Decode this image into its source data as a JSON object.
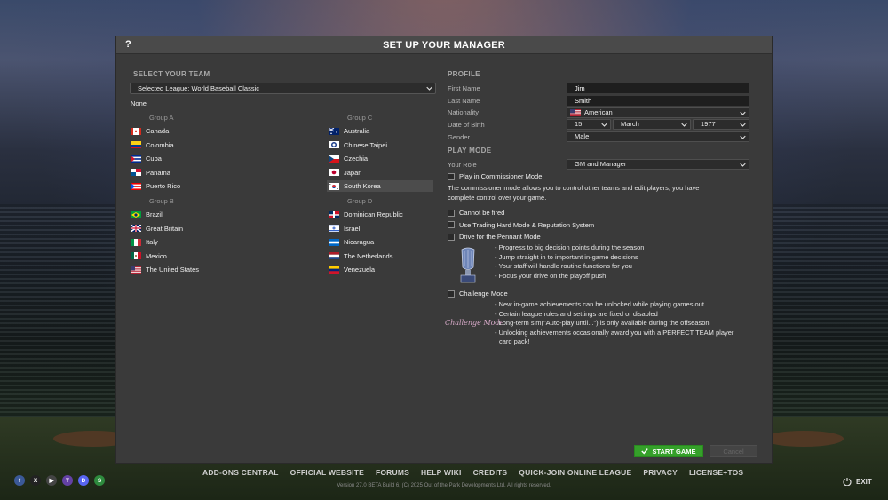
{
  "dialog": {
    "title": "SET UP YOUR MANAGER",
    "help_label": "?"
  },
  "team_section": {
    "header": "SELECT YOUR TEAM",
    "league_select": "Selected League: World Baseball Classic",
    "none_label": "None",
    "groups": [
      {
        "name": "Group A",
        "teams": [
          {
            "name": "Canada",
            "flag": "canada-flag-icon"
          },
          {
            "name": "Colombia",
            "flag": "colombia-flag-icon"
          },
          {
            "name": "Cuba",
            "flag": "cuba-flag-icon"
          },
          {
            "name": "Panama",
            "flag": "panama-flag-icon"
          },
          {
            "name": "Puerto Rico",
            "flag": "puerto-rico-flag-icon"
          }
        ]
      },
      {
        "name": "Group B",
        "teams": [
          {
            "name": "Brazil",
            "flag": "brazil-flag-icon"
          },
          {
            "name": "Great Britain",
            "flag": "great-britain-flag-icon"
          },
          {
            "name": "Italy",
            "flag": "italy-flag-icon"
          },
          {
            "name": "Mexico",
            "flag": "mexico-flag-icon"
          },
          {
            "name": "The United States",
            "flag": "usa-flag-icon"
          }
        ]
      },
      {
        "name": "Group C",
        "teams": [
          {
            "name": "Australia",
            "flag": "australia-flag-icon"
          },
          {
            "name": "Chinese Taipei",
            "flag": "chinese-taipei-flag-icon"
          },
          {
            "name": "Czechia",
            "flag": "czechia-flag-icon"
          },
          {
            "name": "Japan",
            "flag": "japan-flag-icon"
          },
          {
            "name": "South Korea",
            "flag": "south-korea-flag-icon",
            "selected": true
          }
        ]
      },
      {
        "name": "Group D",
        "teams": [
          {
            "name": "Dominican Republic",
            "flag": "dominican-republic-flag-icon"
          },
          {
            "name": "Israel",
            "flag": "israel-flag-icon"
          },
          {
            "name": "Nicaragua",
            "flag": "nicaragua-flag-icon"
          },
          {
            "name": "The Netherlands",
            "flag": "netherlands-flag-icon"
          },
          {
            "name": "Venezuela",
            "flag": "venezuela-flag-icon"
          }
        ]
      }
    ]
  },
  "profile": {
    "header": "PROFILE",
    "first_name_label": "First Name",
    "first_name_value": "Jim",
    "last_name_label": "Last Name",
    "last_name_value": "Smith",
    "nationality_label": "Nationality",
    "nationality_value": "American",
    "dob_label": "Date of Birth",
    "dob_day": "15",
    "dob_month": "March",
    "dob_year": "1977",
    "gender_label": "Gender",
    "gender_value": "Male"
  },
  "play_mode": {
    "header": "PLAY MODE",
    "role_label": "Your Role",
    "role_value": "GM and Manager",
    "commissioner_label": "Play in Commissioner Mode",
    "commissioner_desc_1": "The commissioner mode allows you to control other teams and edit players; you have",
    "commissioner_desc_2": "complete control over your game.",
    "cannot_be_fired_label": "Cannot be fired",
    "trading_hard_label": "Use Trading Hard Mode & Reputation System",
    "pennant_label": "Drive for the Pennant Mode",
    "pennant_bullets": [
      "- Progress to big decision points during the season",
      "- Jump straight in to important in-game decisions",
      "- Your staff will handle routine functions for you",
      "- Focus your drive on the playoff push"
    ],
    "challenge_label": "Challenge Mode",
    "challenge_logo_text": "Challenge Mode",
    "challenge_bullets": [
      "- New in-game achievements can be unlocked while playing games out",
      "- Certain league rules and settings are fixed or disabled",
      "- Long-term sim(\"Auto-play until...\") is only available during the offseason",
      "- Unlocking achievements occasionally award you with a PERFECT TEAM player",
      "card pack!"
    ]
  },
  "buttons": {
    "start": "START GAME",
    "cancel": "Cancel"
  },
  "footer": {
    "links": [
      "ADD-ONS CENTRAL",
      "OFFICIAL WEBSITE",
      "FORUMS",
      "HELP WIKI",
      "CREDITS",
      "QUICK-JOIN ONLINE LEAGUE",
      "PRIVACY",
      "LICENSE+TOS"
    ],
    "version": "Version 27.0 BETA Build 6, (C) 2025 Out of the Park Developments Ltd. All rights reserved.",
    "exit": "EXIT",
    "social": [
      {
        "icon": "facebook-icon",
        "glyph": "f",
        "color": "#3b5998"
      },
      {
        "icon": "x-icon",
        "glyph": "X",
        "color": "#222222"
      },
      {
        "icon": "youtube-icon",
        "glyph": "▶",
        "color": "#444444"
      },
      {
        "icon": "twitch-icon",
        "glyph": "T",
        "color": "#6441a5"
      },
      {
        "icon": "discord-icon",
        "glyph": "D",
        "color": "#5865f2"
      },
      {
        "icon": "ootp-icon",
        "glyph": "S",
        "color": "#2e8b3e"
      }
    ]
  },
  "colors": {
    "accent_green": "#35a02a",
    "dialog_bg": "#3a3a3a"
  }
}
